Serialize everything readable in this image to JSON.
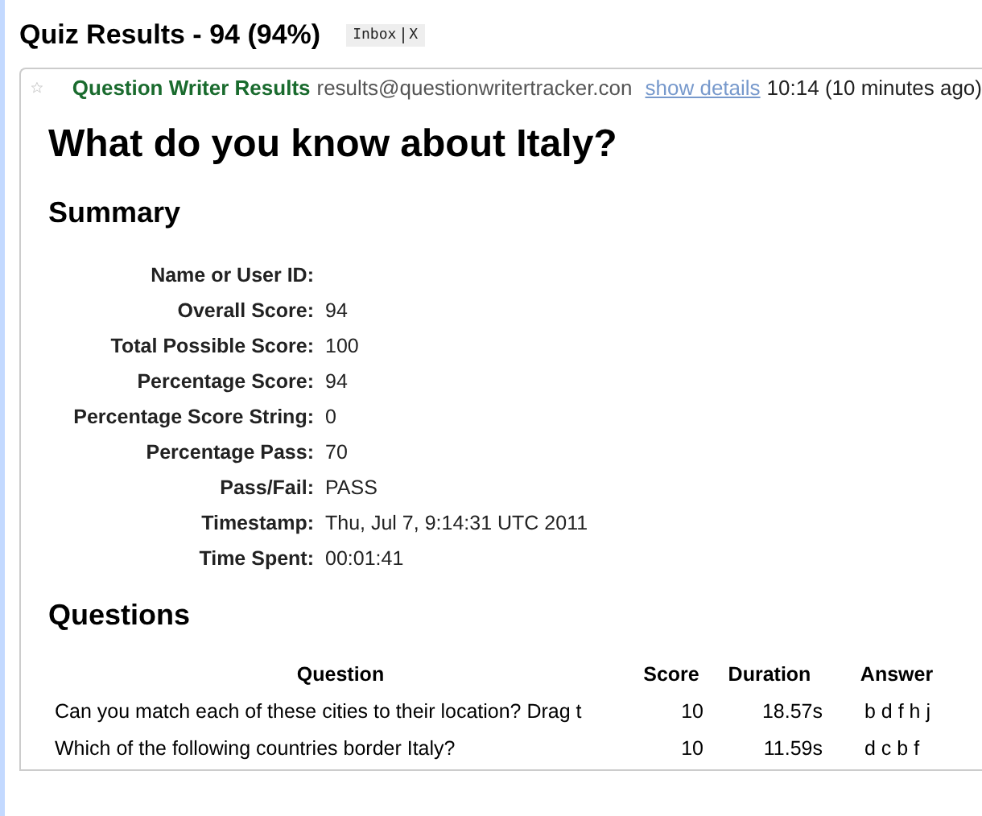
{
  "thread": {
    "subject": "Quiz Results - 94 (94%)",
    "label": "Inbox",
    "label_remove": "X"
  },
  "message": {
    "starred": false,
    "sender": "Question Writer Results",
    "address": "results@questionwritertracker.con",
    "details_link": "show details",
    "time": "10:14 (10 minutes ago)"
  },
  "title": "What do you know about Italy?",
  "summary": {
    "heading": "Summary",
    "rows": [
      {
        "label": "Name or User ID:",
        "value": ""
      },
      {
        "label": "Overall Score:",
        "value": "94"
      },
      {
        "label": "Total Possible Score:",
        "value": "100"
      },
      {
        "label": "Percentage Score:",
        "value": "94"
      },
      {
        "label": "Percentage Score String:",
        "value": "0"
      },
      {
        "label": "Percentage Pass:",
        "value": "70"
      },
      {
        "label": "Pass/Fail:",
        "value": "PASS"
      },
      {
        "label": "Timestamp:",
        "value": "Thu, Jul 7, 9:14:31 UTC 2011"
      },
      {
        "label": "Time Spent:",
        "value": "00:01:41"
      }
    ]
  },
  "questions": {
    "heading": "Questions",
    "columns": [
      "Question",
      "Score",
      "Duration",
      "Answer"
    ],
    "rows": [
      {
        "question": "Can you match each of these cities to their location? Drag t",
        "score": "10",
        "duration": "18.57s",
        "answer": "b d f h j"
      },
      {
        "question": "Which of the following countries border Italy?",
        "score": "10",
        "duration": "11.59s",
        "answer": "d c b f"
      }
    ]
  }
}
